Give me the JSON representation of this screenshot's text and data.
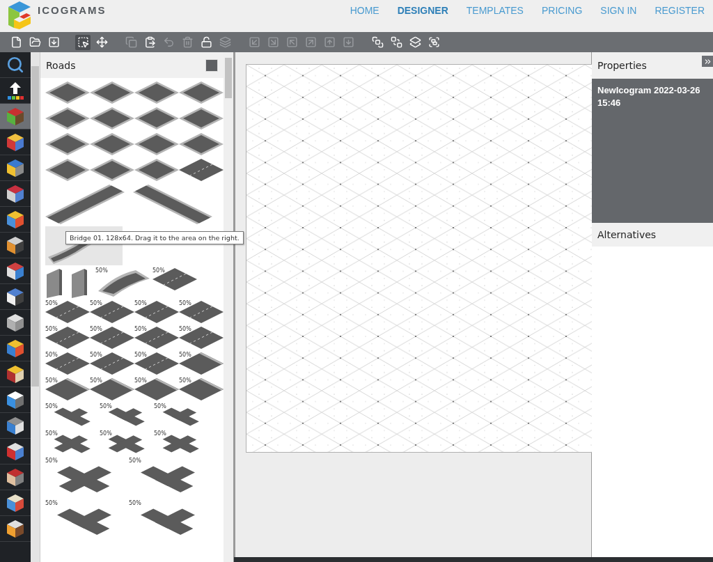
{
  "header": {
    "logo": "ICOGRAMS",
    "nav": [
      {
        "label": "HOME",
        "selected": false
      },
      {
        "label": "DESIGNER",
        "selected": true
      },
      {
        "label": "TEMPLATES",
        "selected": false
      },
      {
        "label": "PRICING",
        "selected": false
      },
      {
        "label": "SIGN IN",
        "selected": false
      },
      {
        "label": "REGISTER",
        "selected": false
      }
    ]
  },
  "toolbar": [
    [
      {
        "kind": "new",
        "disabled": false,
        "selected": false
      },
      {
        "kind": "open",
        "disabled": false,
        "selected": false
      },
      {
        "kind": "save",
        "disabled": false,
        "selected": false
      }
    ],
    [
      {
        "kind": "select",
        "disabled": false,
        "selected": true
      },
      {
        "kind": "move",
        "disabled": false,
        "selected": false
      }
    ],
    [
      {
        "kind": "copy",
        "disabled": true,
        "selected": false
      },
      {
        "kind": "paste",
        "disabled": false,
        "selected": false
      },
      {
        "kind": "undo",
        "disabled": true,
        "selected": false
      },
      {
        "kind": "delete",
        "disabled": true,
        "selected": false
      },
      {
        "kind": "unlock",
        "disabled": false,
        "selected": false
      },
      {
        "kind": "group",
        "disabled": true,
        "selected": false
      }
    ],
    [
      {
        "kind": "down-left",
        "disabled": true,
        "selected": false
      },
      {
        "kind": "down-right",
        "disabled": true,
        "selected": false
      },
      {
        "kind": "up-left",
        "disabled": true,
        "selected": false
      },
      {
        "kind": "up-right",
        "disabled": true,
        "selected": false
      },
      {
        "kind": "up",
        "disabled": true,
        "selected": false
      },
      {
        "kind": "down",
        "disabled": true,
        "selected": false
      }
    ],
    [
      {
        "kind": "front",
        "disabled": false,
        "selected": false
      },
      {
        "kind": "back",
        "disabled": false,
        "selected": false
      },
      {
        "kind": "forward",
        "disabled": false,
        "selected": false
      },
      {
        "kind": "backward",
        "disabled": false,
        "selected": false
      }
    ]
  ],
  "categories": [
    {
      "kind": "search",
      "selected": false
    },
    {
      "kind": "upload",
      "selected": false
    },
    {
      "kind": "block",
      "selected": true
    },
    {
      "kind": "block",
      "selected": false
    },
    {
      "kind": "block",
      "selected": false
    },
    {
      "kind": "block",
      "selected": false
    },
    {
      "kind": "block",
      "selected": false
    },
    {
      "kind": "block",
      "selected": false
    },
    {
      "kind": "block",
      "selected": false
    },
    {
      "kind": "block",
      "selected": false
    },
    {
      "kind": "block",
      "selected": false
    },
    {
      "kind": "block",
      "selected": false
    },
    {
      "kind": "block",
      "selected": false
    },
    {
      "kind": "block",
      "selected": false
    },
    {
      "kind": "block",
      "selected": false
    },
    {
      "kind": "block",
      "selected": false
    },
    {
      "kind": "block",
      "selected": false
    },
    {
      "kind": "block",
      "selected": false
    },
    {
      "kind": "block",
      "selected": false
    }
  ],
  "palette": {
    "title": "Roads",
    "tooltip": "Bridge 01. 128x64. Drag it to the area on the right.",
    "rows": [
      [
        {
          "kind": "square",
          "selected": false
        },
        {
          "kind": "square",
          "selected": false
        },
        {
          "kind": "square",
          "selected": false
        },
        {
          "kind": "square",
          "selected": false
        }
      ],
      [
        {
          "kind": "square",
          "selected": false
        },
        {
          "kind": "square",
          "selected": false
        },
        {
          "kind": "square",
          "selected": false
        },
        {
          "kind": "square",
          "selected": false
        }
      ],
      [
        {
          "kind": "square",
          "selected": false
        },
        {
          "kind": "square",
          "selected": false
        },
        {
          "kind": "square",
          "selected": false
        },
        {
          "kind": "square",
          "selected": false
        }
      ],
      [
        {
          "kind": "square",
          "selected": false
        },
        {
          "kind": "square",
          "selected": false
        },
        {
          "kind": "square",
          "selected": false
        },
        {
          "kind": "lane",
          "selected": false
        }
      ],
      [
        {
          "kind": "long",
          "selected": false
        },
        {
          "kind": "long-r",
          "selected": false
        }
      ],
      [
        {
          "kind": "bridge",
          "selected": true
        }
      ],
      [
        {
          "kind": "wall",
          "selected": false
        },
        {
          "kind": "wall",
          "selected": false
        },
        {
          "kind": "arch",
          "selected": false,
          "label": "50%"
        },
        {
          "kind": "lane",
          "selected": false,
          "label": "50%"
        }
      ],
      [
        {
          "kind": "lane",
          "selected": false,
          "label": "50%"
        },
        {
          "kind": "lane",
          "selected": false,
          "label": "50%"
        },
        {
          "kind": "lane",
          "selected": false,
          "label": "50%"
        },
        {
          "kind": "lane",
          "selected": false,
          "label": "50%"
        }
      ],
      [
        {
          "kind": "lane",
          "selected": false,
          "label": "50%"
        },
        {
          "kind": "lane",
          "selected": false,
          "label": "50%"
        },
        {
          "kind": "lane",
          "selected": false,
          "label": "50%"
        },
        {
          "kind": "lane",
          "selected": false,
          "label": "50%"
        }
      ],
      [
        {
          "kind": "lane",
          "selected": false,
          "label": "50%"
        },
        {
          "kind": "lane",
          "selected": false,
          "label": "50%"
        },
        {
          "kind": "lane",
          "selected": false,
          "label": "50%"
        },
        {
          "kind": "plain",
          "selected": false,
          "label": "50%"
        }
      ],
      [
        {
          "kind": "plain",
          "selected": false,
          "label": "50%"
        },
        {
          "kind": "plain",
          "selected": false,
          "label": "50%"
        },
        {
          "kind": "plain",
          "selected": false,
          "label": "50%"
        },
        {
          "kind": "plain",
          "selected": false,
          "label": "50%"
        }
      ],
      [
        {
          "kind": "tee",
          "selected": false,
          "label": "50%"
        },
        {
          "kind": "tee",
          "selected": false,
          "label": "50%"
        },
        {
          "kind": "tee",
          "selected": false,
          "label": "50%"
        }
      ],
      [
        {
          "kind": "cross",
          "selected": false,
          "label": "50%"
        },
        {
          "kind": "cross",
          "selected": false,
          "label": "50%"
        },
        {
          "kind": "cross",
          "selected": false,
          "label": "50%"
        }
      ],
      [
        {
          "kind": "big-cross",
          "selected": false,
          "label": "50%"
        },
        {
          "kind": "big-tee",
          "selected": false,
          "label": "50%"
        }
      ],
      [
        {
          "kind": "big-tee",
          "selected": false,
          "label": "50%"
        },
        {
          "kind": "big-tee",
          "selected": false,
          "label": "50%"
        }
      ]
    ]
  },
  "properties": {
    "title": "Properties",
    "name": "NewIcogram 2022-03-26 15:46"
  },
  "alternatives": {
    "title": "Alternatives"
  }
}
